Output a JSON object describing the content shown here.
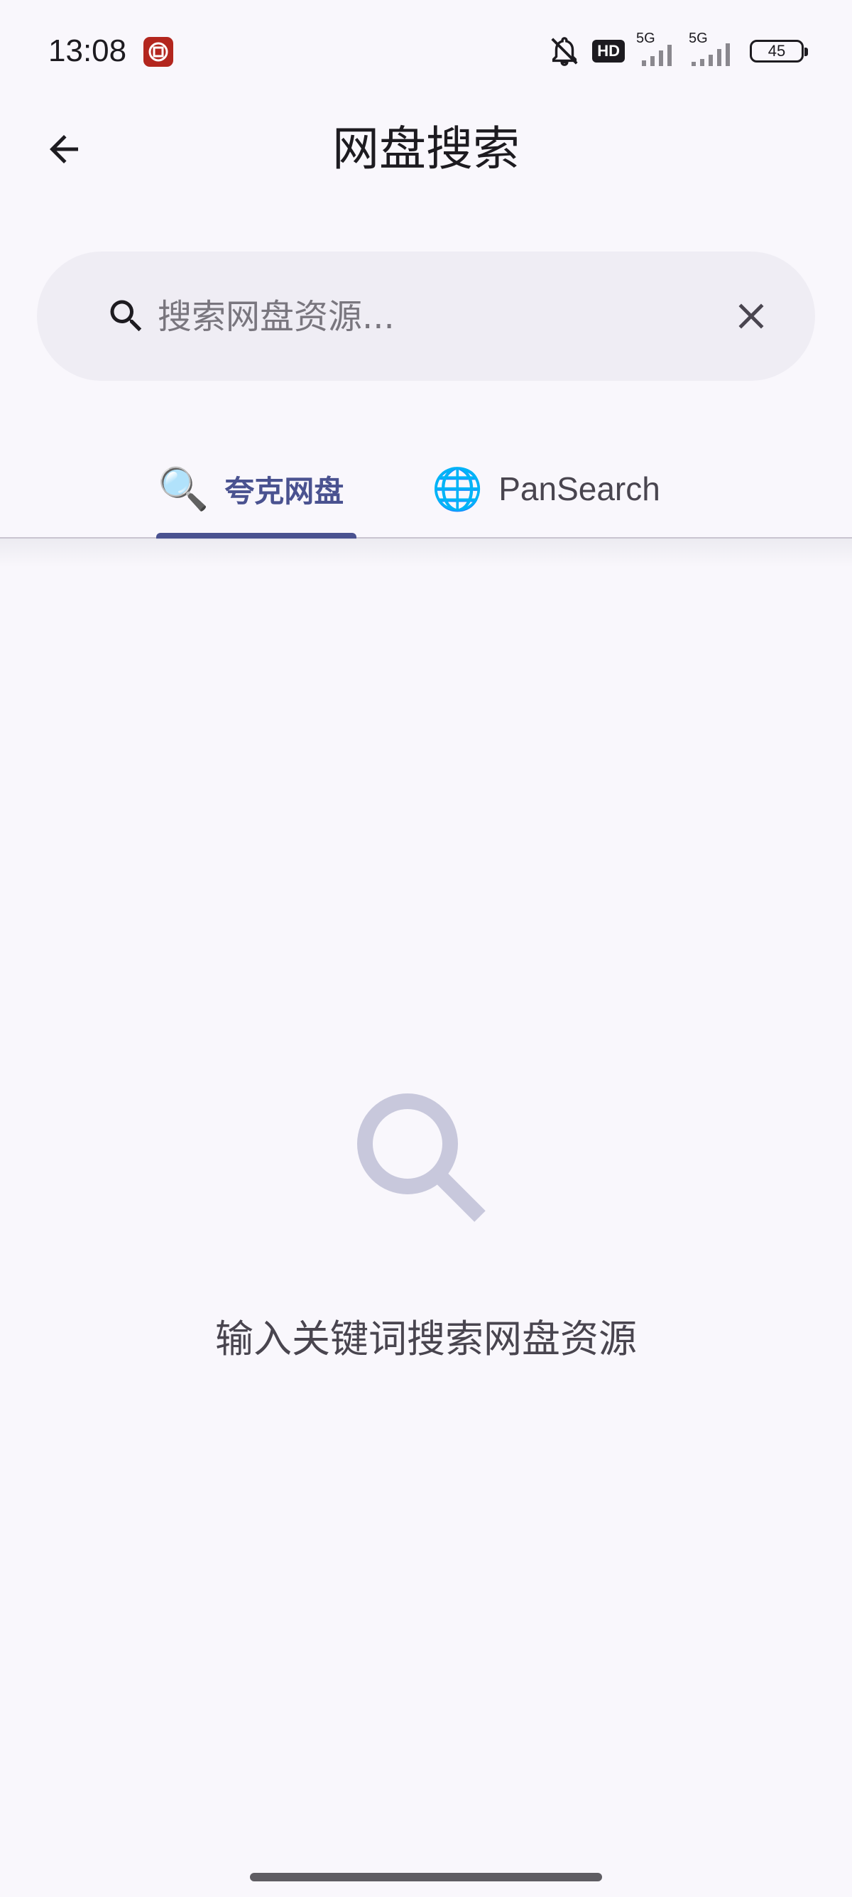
{
  "status_bar": {
    "time": "13:08",
    "network_1": "5G",
    "network_2": "5G",
    "hd_label": "HD",
    "battery_level": "45"
  },
  "header": {
    "title": "网盘搜索",
    "back_icon": "arrow-left-icon"
  },
  "search": {
    "value": "",
    "placeholder": "搜索网盘资源...",
    "leading_icon": "search-icon",
    "clear_icon": "close-icon"
  },
  "tabs": {
    "selected": 0,
    "items": [
      {
        "emoji": "🔍",
        "label": "夸克网盘"
      },
      {
        "emoji": "🌐",
        "label": "PanSearch"
      }
    ]
  },
  "empty_state": {
    "icon": "search-icon",
    "message": "输入关键词搜索网盘资源"
  },
  "colors": {
    "background": "#f9f7fc",
    "search_field": "#efedf4",
    "accent": "#4a5290",
    "empty_icon": "#c8c8dc",
    "text_secondary": "#49454f"
  }
}
